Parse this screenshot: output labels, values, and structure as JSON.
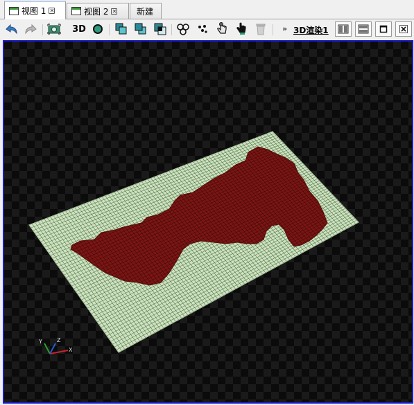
{
  "tabs": [
    {
      "label": "视图 1",
      "active": true
    },
    {
      "label": "视图 2",
      "active": false
    },
    {
      "label": "新建",
      "active": false
    }
  ],
  "toolbar": {
    "mode_3d_label": "3D",
    "overflow_glyph": "»",
    "render_label": "3D渲染1",
    "icons": [
      "undo-icon",
      "redo-icon",
      "camera-icon",
      "3d-icon",
      "sphere-icon",
      "layer-front-icon",
      "layer-back-icon",
      "layer-merge-icon",
      "nodes-icon",
      "points-icon",
      "pick-icon",
      "pointer-icon",
      "trash-icon"
    ]
  },
  "axis_triad": {
    "x": "X",
    "y": "Y",
    "z": "Z"
  },
  "colors": {
    "selection_border": "#1b1bd0",
    "mesh_fill": "#cfe2c0",
    "mesh_lines": "#2f5a2f",
    "region_fill": "#7a1614",
    "axis_x": "#c8232c",
    "axis_y": "#2aa02a",
    "axis_z": "#2a5ad0"
  }
}
